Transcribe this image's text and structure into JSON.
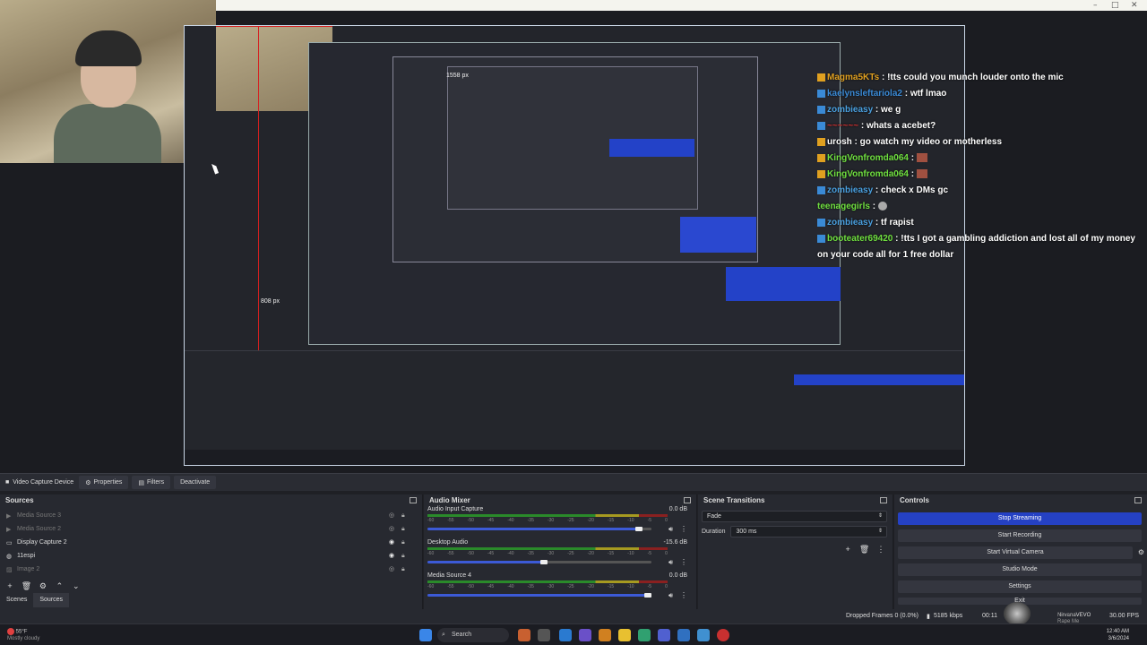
{
  "window": {
    "minimize": "–",
    "maximize": "□",
    "close": "✕"
  },
  "stream_preview": {
    "px_labels": [
      "1558 px",
      "808 px"
    ],
    "chat": [
      {
        "user": "Magma5KTs",
        "color": "#e0a020",
        "text": "!tts could you munch louder onto the mic"
      },
      {
        "user": "kaelynsleftariola2",
        "color": "#3a8ad6",
        "text": "wtf lmao"
      },
      {
        "user": "zombieasy",
        "color": "#4aa0e0",
        "text": "we g"
      },
      {
        "user": "~~~~~~",
        "color": "#d03030",
        "text": "whats a acebet?"
      },
      {
        "user": "urosh",
        "color": "#ffffff",
        "text": "go watch my video or motherless"
      },
      {
        "user": "KingVonfromda064",
        "color": "#70e040",
        "text": ""
      },
      {
        "user": "KingVonfromda064",
        "color": "#70e040",
        "text": ""
      },
      {
        "user": "zombieasy",
        "color": "#4aa0e0",
        "text": "check x DMs gc"
      },
      {
        "user": "teenagegirls",
        "color": "#70e040",
        "text": ""
      },
      {
        "user": "zombieasy",
        "color": "#4aa0e0",
        "text": "tf rapist"
      },
      {
        "user": "booteater69420",
        "color": "#70e040",
        "text": "!tts I got a gambling addiction and lost all of my money on your code all for 1 free dollar"
      }
    ]
  },
  "source_toolbar": {
    "source_name": "Video Capture Device",
    "properties": "Properties",
    "filters": "Filters",
    "deactivate": "Deactivate"
  },
  "sources": {
    "title": "Sources",
    "items": [
      {
        "label": "Media Source 3",
        "dim": true
      },
      {
        "label": "Media Source 2",
        "dim": true
      },
      {
        "label": "Display Capture 2",
        "dim": false
      },
      {
        "label": "11espi",
        "dim": false
      },
      {
        "label": "Image 2",
        "dim": true
      }
    ],
    "tabs": {
      "scenes": "Scenes",
      "sources": "Sources"
    }
  },
  "audio_mixer": {
    "title": "Audio Mixer",
    "ticks": [
      "-60",
      "-55",
      "-50",
      "-45",
      "-40",
      "-35",
      "-30",
      "-25",
      "-20",
      "-15",
      "-10",
      "-5",
      "0"
    ],
    "tracks": [
      {
        "name": "Audio Input Capture",
        "db": "0.0 dB",
        "volume": 0.96
      },
      {
        "name": "Desktop Audio",
        "db": "-15.6 dB",
        "volume": 0.52
      },
      {
        "name": "Media Source 4",
        "db": "0.0 dB",
        "volume": 1.0
      }
    ]
  },
  "scene_transitions": {
    "title": "Scene Transitions",
    "transition": "Fade",
    "duration_label": "Duration",
    "duration_value": "300 ms"
  },
  "controls": {
    "title": "Controls",
    "buttons": {
      "stop_streaming": "Stop Streaming",
      "start_recording": "Start Recording",
      "start_virtual_camera": "Start Virtual Camera",
      "studio_mode": "Studio Mode",
      "settings": "Settings",
      "exit": "Exit"
    }
  },
  "status": {
    "dropped_frames": "Dropped Frames 0 (0.0%)",
    "bitrate": "5185 kbps",
    "time": "00:11",
    "fps": "30.00 FPS",
    "now_playing_title": "NirvanaVEVO",
    "now_playing_sub": "Nirvana - Rape Me (Visualizer)"
  },
  "taskbar": {
    "weather_temp": "55°F",
    "weather_desc": "Mostly cloudy",
    "search": "Search",
    "time": "12:40 AM",
    "date": "3/6/2024"
  },
  "colors": {
    "accent": "#2541c4",
    "panel": "#272930",
    "background": "#1f2025"
  }
}
